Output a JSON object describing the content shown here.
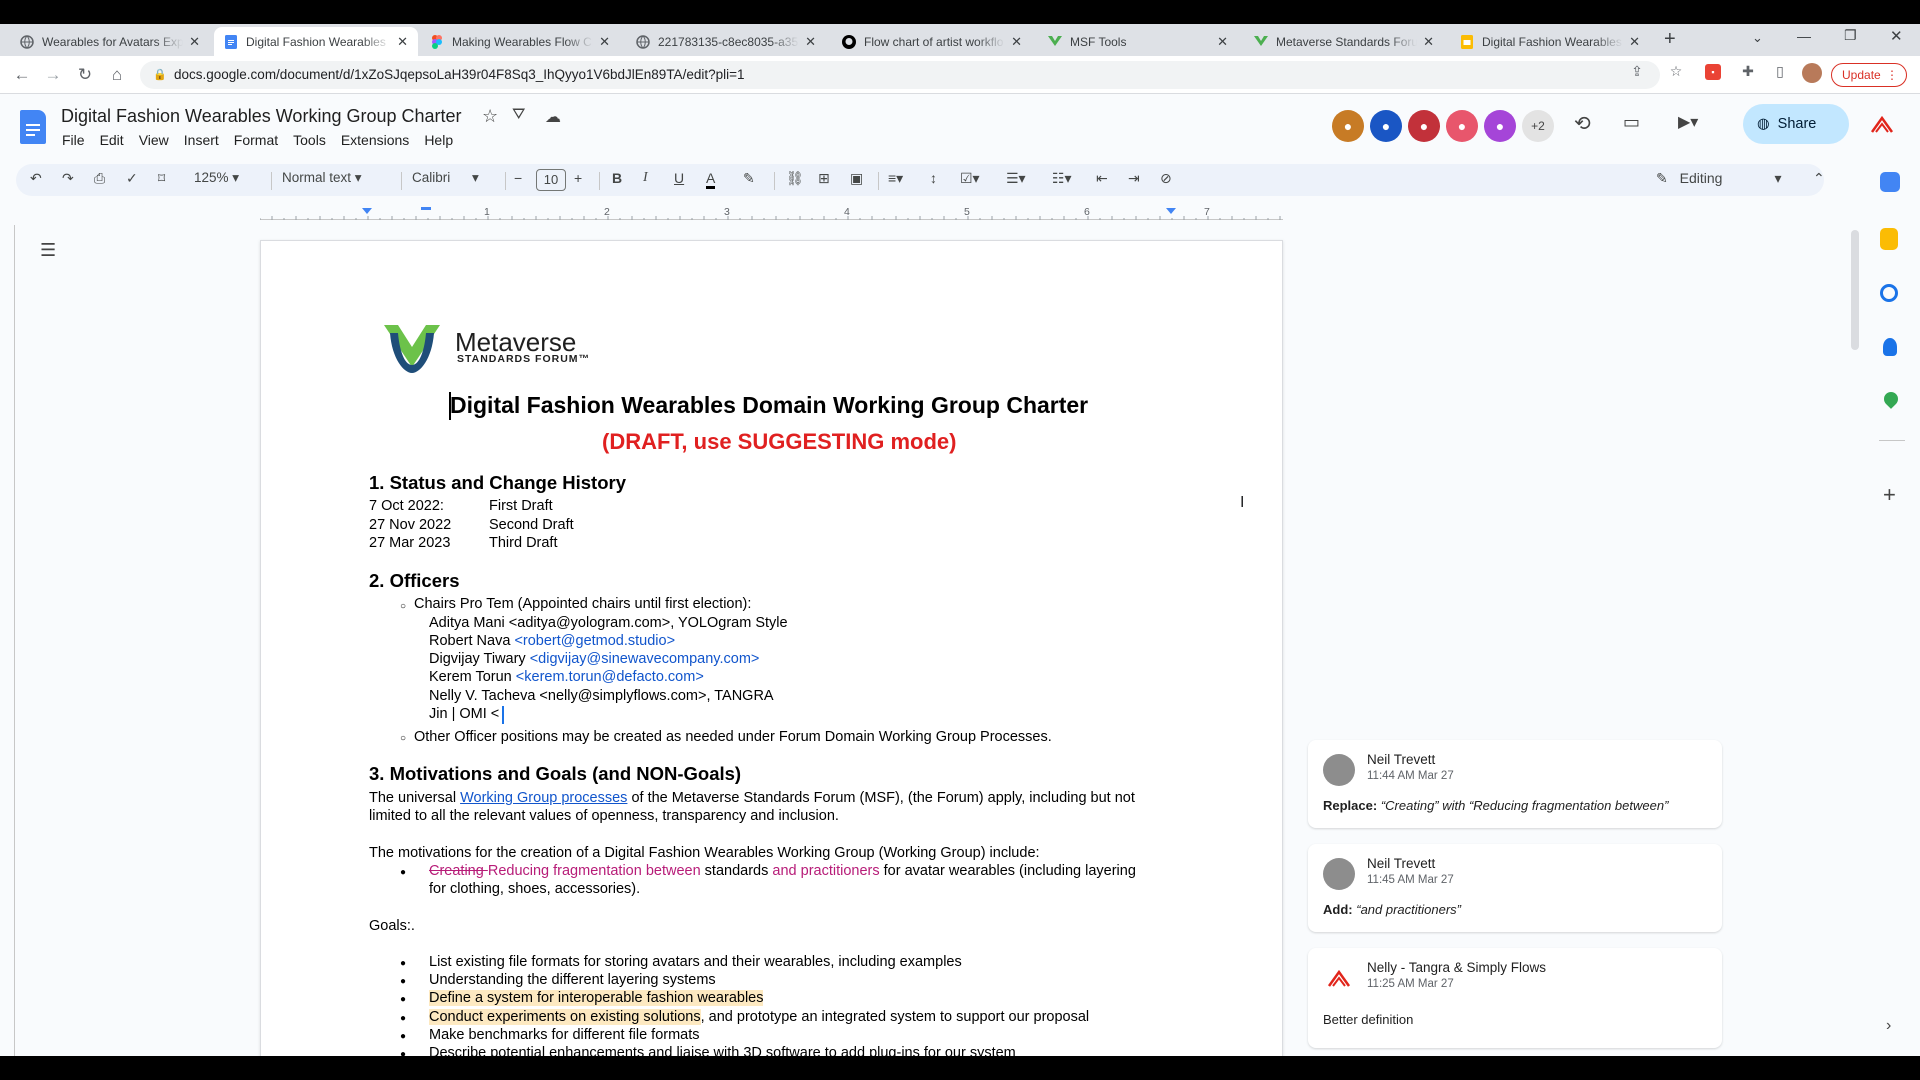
{
  "browser": {
    "tabs": [
      {
        "title": "Wearables for Avatars Expl",
        "icon": "msf-icon",
        "color": "#5f6368",
        "active": false
      },
      {
        "title": "Digital Fashion Wearables",
        "icon": "docs-icon",
        "color": "#4285f4",
        "active": true
      },
      {
        "title": "Making Wearables Flow Ch",
        "icon": "figma-icon",
        "color": "#f24e1e",
        "active": false
      },
      {
        "title": "221783135-c8ec8035-a35",
        "icon": "globe-icon",
        "color": "#5f6368",
        "active": false
      },
      {
        "title": "Flow chart of artist workflo",
        "icon": "github-icon",
        "color": "#000000",
        "active": false
      },
      {
        "title": "MSF Tools",
        "icon": "msf-icon",
        "color": "#4caf50",
        "active": false
      },
      {
        "title": "Metaverse Standards Foru",
        "icon": "msf-icon",
        "color": "#4caf50",
        "active": false
      },
      {
        "title": "Digital Fashion Wearables",
        "icon": "slides-icon",
        "color": "#fbbc04",
        "active": false
      }
    ],
    "url": "docs.google.com/document/d/1xZoSJqepsoLaH39r04F8Sq3_IhQyyo1V6bdJlEn89TA/edit?pli=1",
    "update_label": "Update"
  },
  "docs": {
    "title": "Digital Fashion Wearables Working Group Charter",
    "menu": [
      "File",
      "Edit",
      "View",
      "Insert",
      "Format",
      "Tools",
      "Extensions",
      "Help"
    ],
    "extra_collaborators": "+2",
    "share_label": "Share",
    "toolbar": {
      "zoom": "125%",
      "style": "Normal text",
      "font": "Calibri",
      "font_size": "10",
      "mode": "Editing"
    },
    "ruler_numbers": [
      "1",
      "2",
      "3",
      "4",
      "5",
      "6",
      "7"
    ]
  },
  "document": {
    "logo_name": "Metaverse",
    "logo_sub": "STANDARDS FORUM™",
    "heading": "Digital Fashion Wearables Domain Working Group Charter",
    "draft_note": "(DRAFT, use SUGGESTING mode)",
    "s1_title": "1.   Status and Change History",
    "history": [
      {
        "date": "7 Oct 2022:",
        "label": "First Draft"
      },
      {
        "date": "27 Nov 2022",
        "label": "Second Draft"
      },
      {
        "date": "27 Mar 2023",
        "label": "Third Draft"
      }
    ],
    "s2_title": "2.   Officers",
    "chairs_intro": "Chairs Pro Tem (Appointed chairs until first election):",
    "chair1": "Aditya Mani <aditya@yologram.com>, YOLOgram Style",
    "chair2_name": "Robert Nava ",
    "chair2_email": "<robert@getmod.studio>",
    "chair3_name": "Digvijay Tiwary ",
    "chair3_email": "<digvijay@sinewavecompany.com>",
    "chair4_name": "Kerem Torun ",
    "chair4_email": "<kerem.torun@defacto.com>",
    "chair5": "Nelly V. Tacheva <nelly@simplyflows.com>, TANGRA",
    "chair6": "Jin | OMI <",
    "other_officers": "Other Officer positions may be created as needed under Forum Domain Working Group Processes.",
    "s3_title": "3.   Motivations and Goals (and NON-Goals)",
    "p1_a": "The universal ",
    "p1_link": "Working Group processes",
    "p1_b": " of the Metaverse Standards Forum (MSF), (the Forum) apply, including but not",
    "p1_c": "limited to all the relevant values of openness, transparency and inclusion.",
    "p2": "The motivations for the creation of a Digital Fashion Wearables Working Group (Working Group) include:",
    "m1_strike": "Creating ",
    "m1_insert": "Reducing fragmentation between",
    "m1_b": " standards ",
    "m1_insert2": "and practitioners",
    "m1_c": " for avatar wearables (including layering",
    "m1_d": "for clothing, shoes, accessories).",
    "goals_label": "Goals:.",
    "goals": [
      "List existing file formats for storing avatars and their wearables, including examples",
      "Understanding the different layering systems",
      "Define a system for interoperable fashion wearables",
      "Conduct experiments on existing solutions",
      "Make benchmarks for different file formats",
      "Describe potential enhancements and liaise with 3D software to add plug-ins for our system"
    ],
    "goal4_tail": ", and prototype an integrated system to support our proposal"
  },
  "comments": [
    {
      "author": "Neil Trevett",
      "time": "11:44 AM Mar 27",
      "action": "Replace:",
      "text": "“Creating” with “Reducing fragmentation between”"
    },
    {
      "author": "Neil Trevett",
      "time": "11:45 AM Mar 27",
      "action": "Add:",
      "text": "“and practitioners”"
    },
    {
      "author": "Nelly - Tangra & Simply Flows",
      "time": "11:25 AM Mar 27",
      "action": "",
      "text": "Better definition"
    }
  ]
}
